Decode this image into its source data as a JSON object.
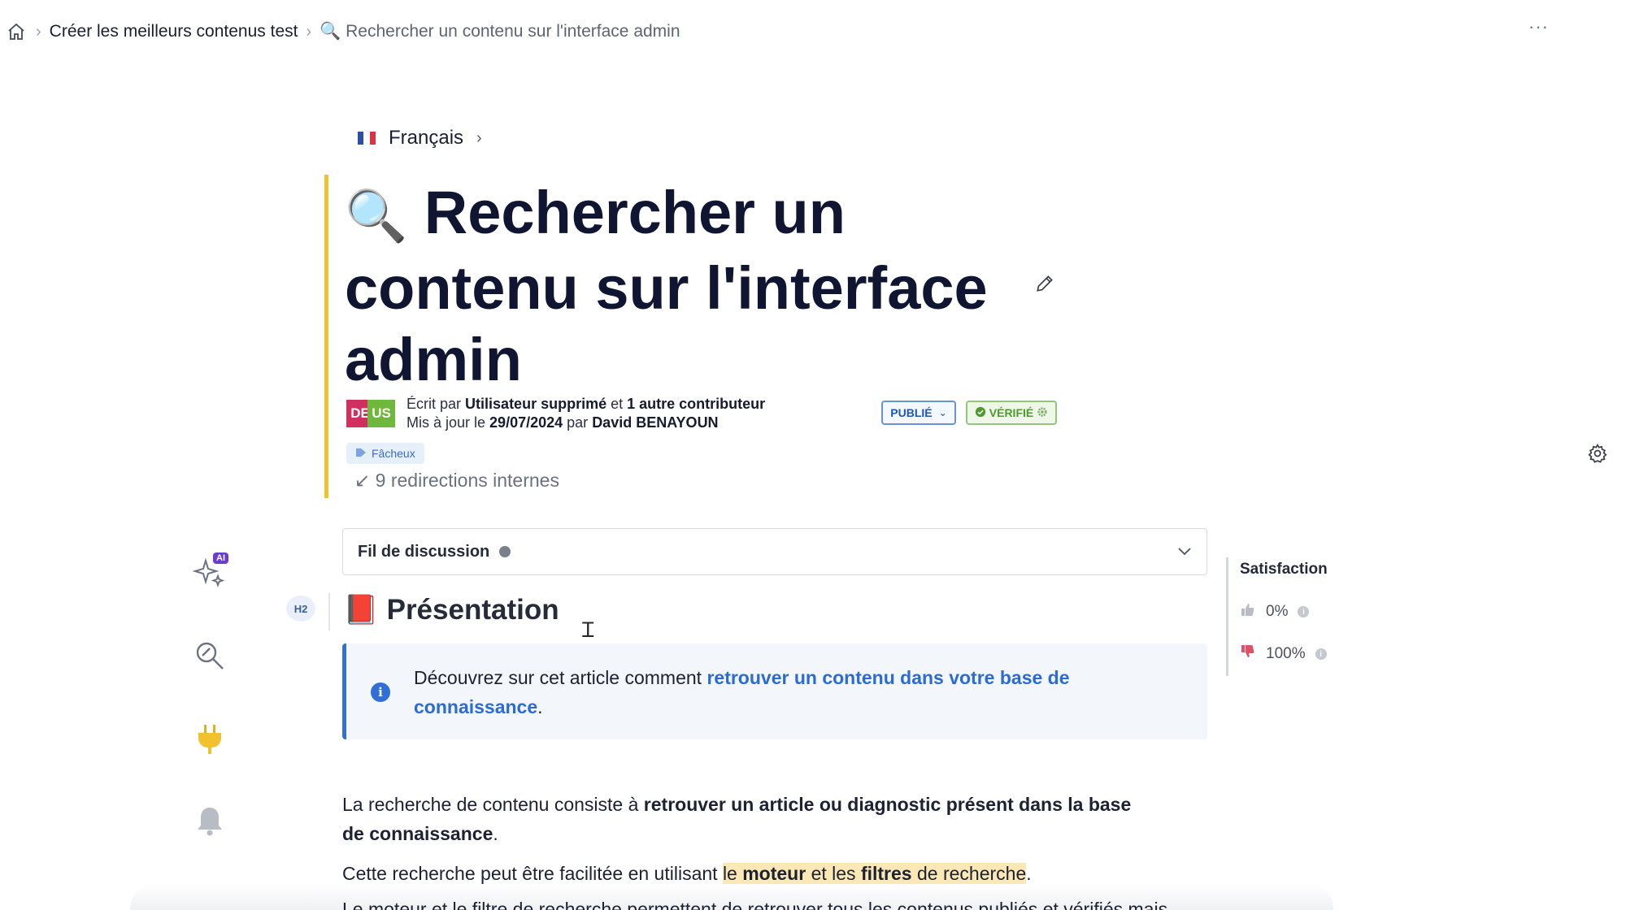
{
  "breadcrumb": {
    "items": [
      "Créer les meilleurs contenus test",
      "🔍 Rechercher un contenu sur l'interface admin"
    ],
    "more": "···"
  },
  "language": {
    "label": "Français"
  },
  "article": {
    "title_icon": "🔍",
    "title": "Rechercher un contenu sur l'interface admin",
    "authors": {
      "avatar1": "DE",
      "avatar2": "US"
    },
    "written_prefix": "Écrit par",
    "written_by": "Utilisateur supprimé",
    "written_and": "et",
    "written_others": "1 autre contributeur",
    "updated_prefix": "Mis à jour le",
    "updated_date": "29/07/2024",
    "updated_by_prefix": "par",
    "updated_by": "David BENAYOUN",
    "status": "PUBLIÉ",
    "verified": "VÉRIFIÉ",
    "tag": "Fâcheux",
    "redirects": "9 redirections internes"
  },
  "discussion": {
    "label": "Fil de discussion"
  },
  "tools": {
    "ai_badge": "AI"
  },
  "section": {
    "level": "H2",
    "icon": "📕",
    "title": "Présentation"
  },
  "info": {
    "text_before": "Découvrez sur cet article comment ",
    "link": "retrouver un contenu dans votre base de connaissance",
    "text_after": "."
  },
  "body": {
    "p1_before": "La recherche de contenu consiste à ",
    "p1_bold": "retrouver un article ou diagnostic présent dans la base de connaissance",
    "p1_after": ".",
    "p2_before": "Cette recherche peut être facilitée en utilisant ",
    "p2_hl1": "le ",
    "p2_hl_bold1": "moteur",
    "p2_hl2": " et les ",
    "p2_hl_bold2": "filtres",
    "p2_hl3": " de recherche",
    "p2_after": ".",
    "p3_partial": "Le moteur et le filtre de recherche permettent de retrouver tous les contenus publiés et vérifiés mais"
  },
  "satisfaction": {
    "title": "Satisfaction",
    "positive": "0%",
    "negative": "100%"
  },
  "colors": {
    "title_accent": "#f2c12e",
    "link": "#2b6bd6",
    "published": "#2054b8",
    "verified": "#4e9a2f"
  }
}
